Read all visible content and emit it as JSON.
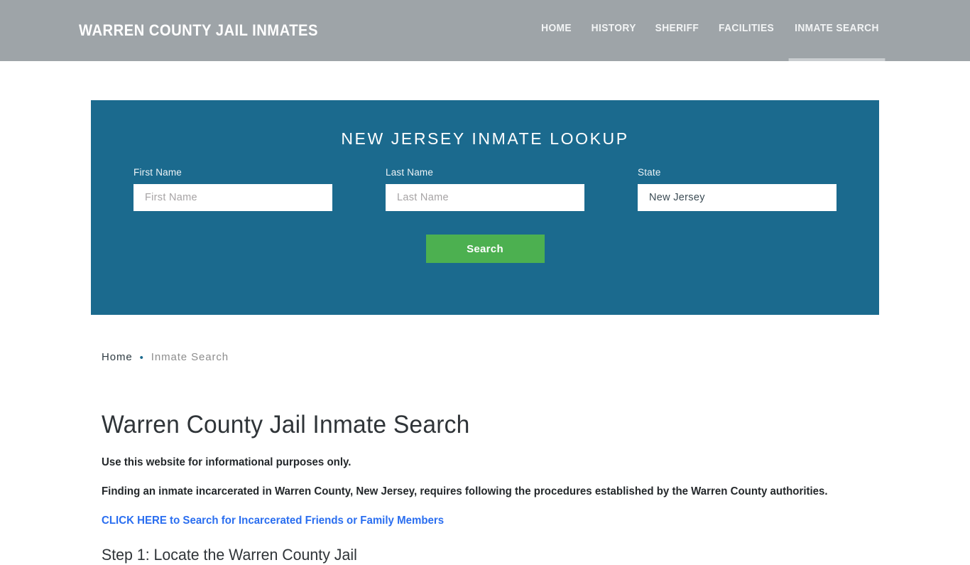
{
  "header": {
    "brand": "WARREN COUNTY JAIL INMATES",
    "background_color": "#9ea4a8",
    "nav": [
      {
        "label": "HOME",
        "active": false
      },
      {
        "label": "HISTORY",
        "active": false
      },
      {
        "label": "SHERIFF",
        "active": false
      },
      {
        "label": "FACILITIES",
        "active": false
      },
      {
        "label": "INMATE SEARCH",
        "active": true
      }
    ]
  },
  "lookup": {
    "title": "NEW JERSEY INMATE LOOKUP",
    "panel_color": "#1b6a8e",
    "fields": {
      "first_name": {
        "label": "First Name",
        "placeholder": "First Name",
        "value": ""
      },
      "last_name": {
        "label": "Last Name",
        "placeholder": "Last Name",
        "value": ""
      },
      "state": {
        "label": "State",
        "placeholder": "State",
        "value": "New Jersey"
      }
    },
    "search_button": "Search",
    "search_button_color": "#4cb050"
  },
  "breadcrumb": {
    "home": "Home",
    "separator": "•",
    "current": "Inmate Search"
  },
  "main": {
    "title": "Warren County Jail Inmate Search",
    "paragraph_1": "Use this website for informational purposes only.",
    "paragraph_2": "Finding an inmate incarcerated in Warren County, New Jersey, requires following the procedures established by the Warren County authorities.",
    "cta_link": "CLICK HERE to Search for Incarcerated Friends or Family Members",
    "cta_link_color": "#2a6ef0",
    "step_1_title": "Step 1: Locate the Warren County Jail"
  }
}
